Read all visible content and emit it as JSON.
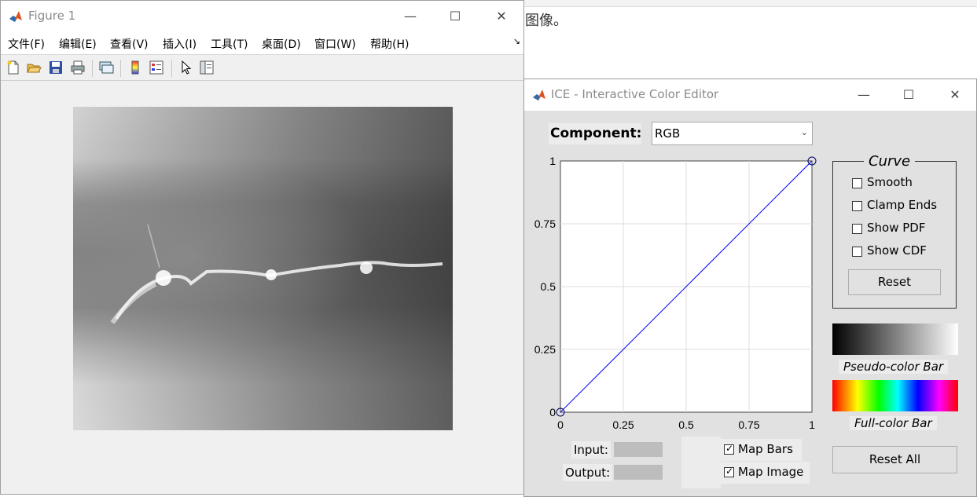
{
  "background_doc": {
    "visible_text": "图像。"
  },
  "figure_window": {
    "title": "Figure 1",
    "controls": {
      "minimize": "—",
      "maximize": "☐",
      "close": "✕"
    },
    "menu": [
      {
        "label": "文件(F)"
      },
      {
        "label": "编辑(E)"
      },
      {
        "label": "查看(V)"
      },
      {
        "label": "插入(I)"
      },
      {
        "label": "工具(T)"
      },
      {
        "label": "桌面(D)"
      },
      {
        "label": "窗口(W)"
      },
      {
        "label": "帮助(H)"
      }
    ],
    "menu_overflow": "↘",
    "toolbar_icons": [
      "new-figure-icon",
      "open-file-icon",
      "save-icon",
      "print-icon",
      "link-plot-icon",
      "insert-colorbar-icon",
      "insert-legend-icon",
      "pointer-icon",
      "property-inspector-icon"
    ]
  },
  "ice_window": {
    "title": "ICE - Interactive Color Editor",
    "controls": {
      "minimize": "—",
      "maximize": "☐",
      "close": "✕"
    },
    "component_label": "Component:",
    "component_value": "RGB",
    "plot": {
      "x_ticks": [
        "0",
        "0.25",
        "0.5",
        "0.75",
        "1"
      ],
      "y_ticks": [
        "0",
        "0.25",
        "0.5",
        "0.75",
        "1"
      ],
      "curve_points": [
        [
          0,
          0
        ],
        [
          1,
          1
        ]
      ],
      "line_color": "#0000ff"
    },
    "input_label": "Input:",
    "output_label": "Output:",
    "map_bars": {
      "label": "Map Bars",
      "checked": true
    },
    "map_image": {
      "label": "Map Image",
      "checked": true
    },
    "curve_group": {
      "title": "Curve",
      "options": [
        {
          "label": "Smooth",
          "checked": false
        },
        {
          "label": "Clamp Ends",
          "checked": false
        },
        {
          "label": "Show PDF",
          "checked": false
        },
        {
          "label": "Show CDF",
          "checked": false
        }
      ],
      "reset_label": "Reset"
    },
    "pseudo_bar_label": "Pseudo-color Bar",
    "full_bar_label": "Full-color Bar",
    "reset_all_label": "Reset All"
  }
}
